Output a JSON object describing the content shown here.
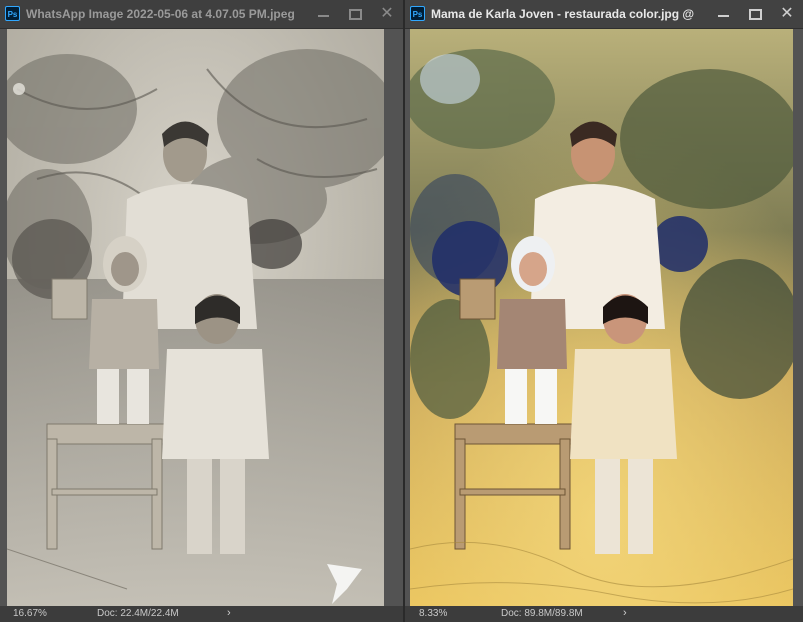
{
  "left_window": {
    "app_icon": "ps-icon",
    "title": "WhatsApp Image 2022-05-06 at 4.07.05 PM.jpeg ...",
    "zoom": "16.67%",
    "doc_size": "Doc: 22.4M/22.4M"
  },
  "right_window": {
    "app_icon": "ps-icon",
    "title": "Mama de Karla Joven - restaurada color.jpg @ 8....",
    "zoom": "8.33%",
    "doc_size": "Doc: 89.8M/89.8M"
  },
  "common": {
    "ps_label": "Ps",
    "status_arrow": "›"
  },
  "colors": {
    "panel_bg": "#535353",
    "titlebar_bg": "#424242",
    "statusbar_bg": "#3c3c3c",
    "ps_blue": "#31a8ff"
  }
}
